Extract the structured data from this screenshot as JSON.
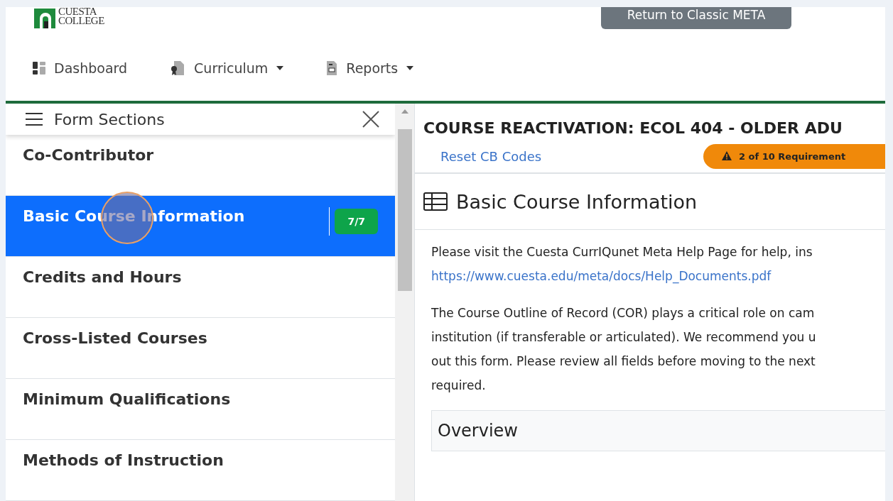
{
  "header": {
    "logo_lines": [
      "CUESTA",
      "COLLEGE"
    ],
    "return_button": "Return to Classic META"
  },
  "nav": [
    {
      "label": "Dashboard",
      "kind": "link"
    },
    {
      "label": "Curriculum",
      "kind": "dropdown"
    },
    {
      "label": "Reports",
      "kind": "dropdown"
    }
  ],
  "sidebar": {
    "title": "Form Sections",
    "items": [
      {
        "label": "Co-Contributor",
        "selected": false
      },
      {
        "label": "Basic Course Information",
        "selected": true,
        "badge": "7/7"
      },
      {
        "label": "Credits and Hours",
        "selected": false
      },
      {
        "label": "Cross-Listed Courses",
        "selected": false
      },
      {
        "label": "Minimum Qualifications",
        "selected": false
      },
      {
        "label": "Methods of Instruction",
        "selected": false
      }
    ]
  },
  "main": {
    "title": "COURSE REACTIVATION: ECOL 404 - OLDER ADU",
    "reset_link": "Reset CB Codes",
    "requirements_badge": "2 of 10 Requirement",
    "section_title": "Basic Course Information",
    "help_line": "Please visit the Cuesta CurrIQunet Meta Help Page for help, ins",
    "help_link": "https://www.cuesta.edu/meta/docs/Help_Documents.pdf",
    "paragraph_lines": [
      "The Course Outline of Record (COR) plays a critical role on cam",
      "institution (if transferable or articulated). We recommend you u",
      "out this form. Please review all fields before moving to the next",
      "required."
    ],
    "panel_title": "Overview"
  }
}
